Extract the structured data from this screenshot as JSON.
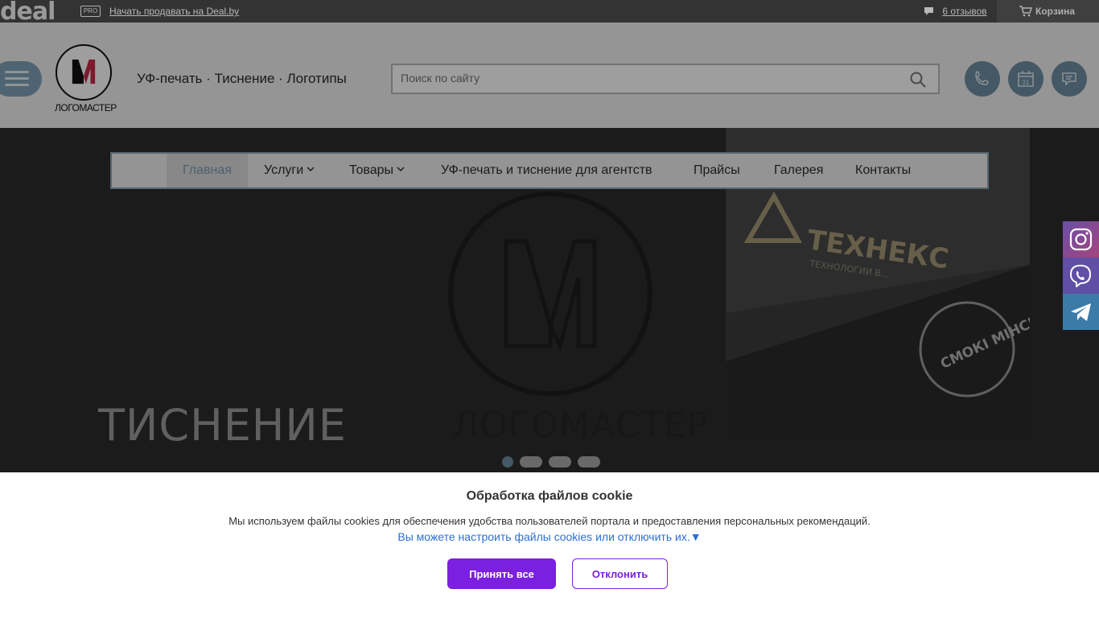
{
  "topbar": {
    "brand": "deal",
    "pro_badge": "PRO",
    "sell_link": "Начать продавать на Deal.by",
    "reviews": "6 отзывов",
    "cart": "Корзина"
  },
  "header": {
    "logo_text": "ЛОГОМАСТЕР",
    "tagline": "УФ-печать · Тиснение · Логотипы",
    "search_placeholder": "Поиск по сайту",
    "calendar_day": "31"
  },
  "nav": {
    "items": [
      {
        "label": "Главная",
        "active": true
      },
      {
        "label": "Услуги",
        "dropdown": true
      },
      {
        "label": "Товары",
        "dropdown": true
      },
      {
        "label": "УФ-печать и тиснение для агентств"
      },
      {
        "label": "Прайсы"
      },
      {
        "label": "Галерея"
      },
      {
        "label": "Контакты"
      }
    ]
  },
  "hero": {
    "title": "ТИСНЕНИЕ",
    "brand": "ЛОГОМАСТЕР",
    "card_text_1": "ТЕХНЕКС",
    "card_text_2": "ТЕХНОЛОГИИ В...",
    "card_text_3": "СМОКІ МІНСК",
    "slides_total": 4,
    "active_slide": 1
  },
  "social": [
    "instagram-icon",
    "viber-icon",
    "telegram-icon"
  ],
  "cookie": {
    "title": "Обработка файлов cookie",
    "description": "Мы используем файлы cookies для обеспечения удобства пользователей портала и предоставления персональных рекомендаций.",
    "settings_link": "Вы можете настроить файлы cookies или отключить их.▼",
    "accept": "Принять все",
    "reject": "Отклонить"
  },
  "colors": {
    "accent": "#7b1fe0",
    "link": "#2a6fd6",
    "header_blue": "#7fa2b8",
    "topbar": "#333333"
  }
}
